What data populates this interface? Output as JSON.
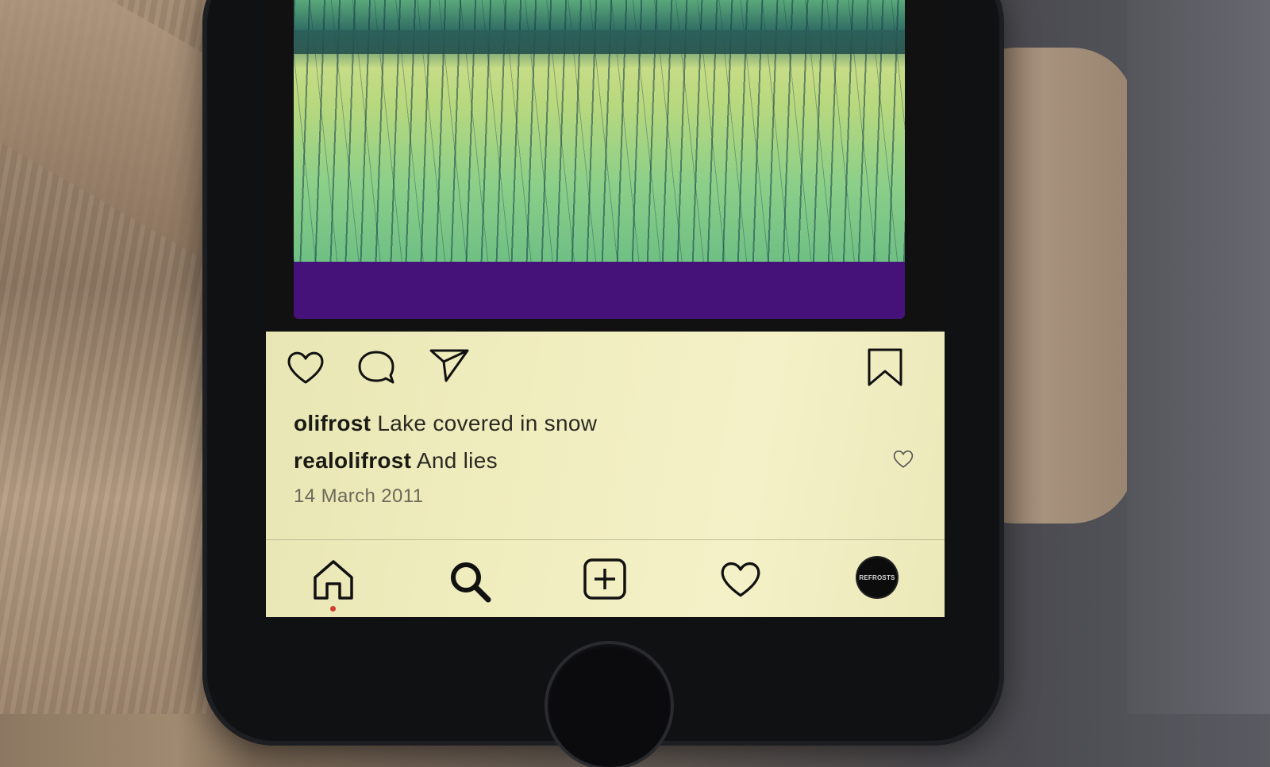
{
  "post": {
    "username": "olifrost",
    "caption": "Lake covered in snow"
  },
  "comment": {
    "username": "realolifrost",
    "text": "And lies"
  },
  "date": "14 March 2011",
  "actions": [
    "heart-icon",
    "comment-icon",
    "send-icon",
    "bookmark-icon"
  ],
  "nav": [
    "home-icon",
    "search-icon",
    "add-post-icon",
    "activity-heart-icon",
    "profile-avatar"
  ],
  "avatar_text": "REFROSTS",
  "colors": {
    "panel_bg": "#f0edbf",
    "purple_band": "#45127a",
    "notification_dot": "#d23c2c",
    "text": "#1a1a14"
  }
}
